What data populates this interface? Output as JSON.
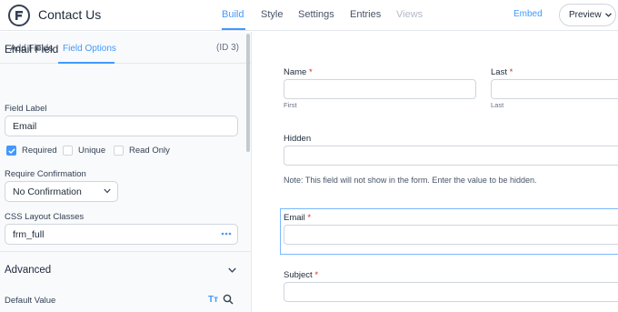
{
  "header": {
    "title": "Contact Us",
    "tabs": [
      {
        "label": "Build",
        "state": "active"
      },
      {
        "label": "Style",
        "state": "normal"
      },
      {
        "label": "Settings",
        "state": "normal"
      },
      {
        "label": "Entries",
        "state": "normal"
      },
      {
        "label": "Views",
        "state": "disabled"
      }
    ],
    "embed_label": "Embed",
    "preview_label": "Preview"
  },
  "sidebar": {
    "tabs": [
      {
        "label": "Add Fields"
      },
      {
        "label": "Field Options"
      }
    ],
    "field_name": "Email Field",
    "field_id": "(ID 3)",
    "field_label_label": "Field Label",
    "field_label_value": "Email",
    "checkboxes": [
      {
        "label": "Required",
        "checked": true
      },
      {
        "label": "Unique",
        "checked": false
      },
      {
        "label": "Read Only",
        "checked": false
      }
    ],
    "confirmation_label": "Require Confirmation",
    "confirmation_value": "No Confirmation",
    "css_label": "CSS Layout Classes",
    "css_value": "frm_full",
    "advanced_title": "Advanced",
    "default_value_label": "Default Value",
    "tt_icon_glyph": "Tт"
  },
  "form": {
    "name_label": "Name",
    "first_sub": "First",
    "last_label": "Last",
    "last_sub": "Last",
    "hidden_label": "Hidden",
    "hidden_note": "Note: This field will not show in the form. Enter the value to be hidden.",
    "email_label": "Email",
    "subject_label": "Subject",
    "required_mark": "*"
  },
  "colors": {
    "accent": "#4199fd",
    "required": "#d92d20",
    "sidebar_bg": "#f9fafb",
    "border": "#d0d5dd"
  },
  "icons": [
    "formidable-logo-icon",
    "chevron-down-icon",
    "checkmark-icon",
    "more-dots-icon",
    "text-format-icon",
    "search-icon"
  ]
}
